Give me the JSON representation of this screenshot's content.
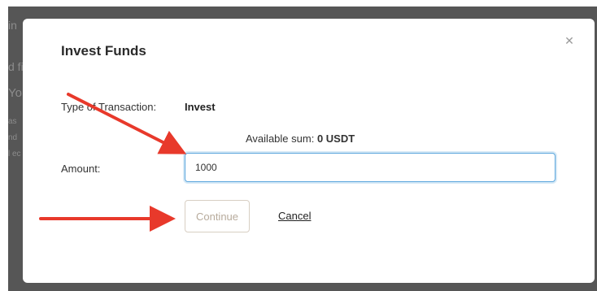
{
  "background": {
    "fragments": [
      "in",
      "d fi",
      "Yo",
      "as",
      "nd",
      "l ec"
    ]
  },
  "modal": {
    "title": "Invest Funds",
    "close_icon": "close-icon",
    "type_label": "Type of Transaction:",
    "type_value": "Invest",
    "available_label": "Available sum:",
    "available_value": "0 USDT",
    "amount_label": "Amount:",
    "amount_value": "1000",
    "continue_label": "Continue",
    "cancel_label": "Cancel"
  },
  "colors": {
    "backdrop": "#565656",
    "input_focus": "#5aa6dd",
    "annotation_arrow": "#e8392b"
  }
}
